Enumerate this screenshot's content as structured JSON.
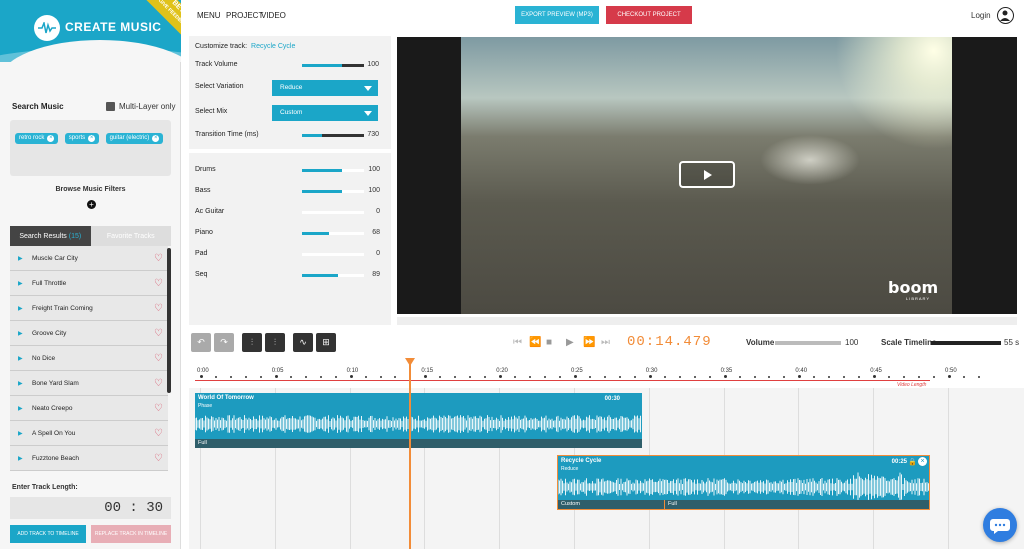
{
  "app": {
    "name": "CREATE MUSIC",
    "beta": "BETA",
    "feedback": "GIVE FEEDBACK"
  },
  "topbar": {
    "menu": "MENU",
    "project": "PROJECT",
    "video": "VIDEO",
    "export_label": "EXPORT PREVIEW (MP3)",
    "checkout_label": "CHECKOUT PROJECT",
    "login": "Login"
  },
  "search": {
    "label": "Search Music",
    "multi_layer": "Multi-Layer only",
    "tags": [
      "retro rock",
      "sports",
      "guitar (electric)"
    ],
    "browse": "Browse Music Filters"
  },
  "tabs": {
    "results": "Search Results",
    "results_count": "(15)",
    "favorites": "Favorite Tracks"
  },
  "results": [
    "Muscle Car City",
    "Full Throttle",
    "Freight Train Coming",
    "Groove City",
    "No Dice",
    "Bone Yard Slam",
    "Neato Creepo",
    "A Spell On You",
    "Fuzztone Beach"
  ],
  "track_length": {
    "label": "Enter Track Length:",
    "value": "00 : 30"
  },
  "buttons": {
    "add": "ADD TRACK TO TIMELINE",
    "replace": "REPLACE TRACK IN TIMELINE"
  },
  "customize": {
    "label": "Customize track:",
    "track": "Recycle Cycle",
    "volume_label": "Track Volume",
    "volume": 100,
    "variation_label": "Select Variation",
    "variation": "Reduce",
    "mix_label": "Select Mix",
    "mix": "Custom",
    "transition_label": "Transition Time (ms)",
    "transition": 730
  },
  "mix": [
    {
      "name": "Drums",
      "value": 100
    },
    {
      "name": "Bass",
      "value": 100
    },
    {
      "name": "Ac Guitar",
      "value": 0
    },
    {
      "name": "Piano",
      "value": 68
    },
    {
      "name": "Pad",
      "value": 0
    },
    {
      "name": "Seq",
      "value": 89
    }
  ],
  "video": {
    "logo": "boom",
    "logo_sub": "LIBRARY"
  },
  "transport": {
    "time": "00:14.479",
    "volume_label": "Volume",
    "volume": 100,
    "scale_label": "Scale Timeline",
    "scale": "55 s"
  },
  "timeline": {
    "ticks": [
      "0:00",
      "0:05",
      "0:10",
      "0:15",
      "0:20",
      "0:25",
      "0:30",
      "0:35",
      "0:40",
      "0:45",
      "0:50"
    ],
    "video_length": "Video Length",
    "clips": [
      {
        "title": "World Of Tomorrow",
        "sub": "Phase",
        "dur": "00:30",
        "foot": "Full"
      },
      {
        "title": "Recycle Cycle",
        "sub": "Reduce",
        "dur": "00:25",
        "foot1": "Custom",
        "foot2": "Full"
      }
    ]
  },
  "colors": {
    "accent": "#1ba6c8",
    "danger": "#d63a4a",
    "playhead": "#f28c38"
  }
}
